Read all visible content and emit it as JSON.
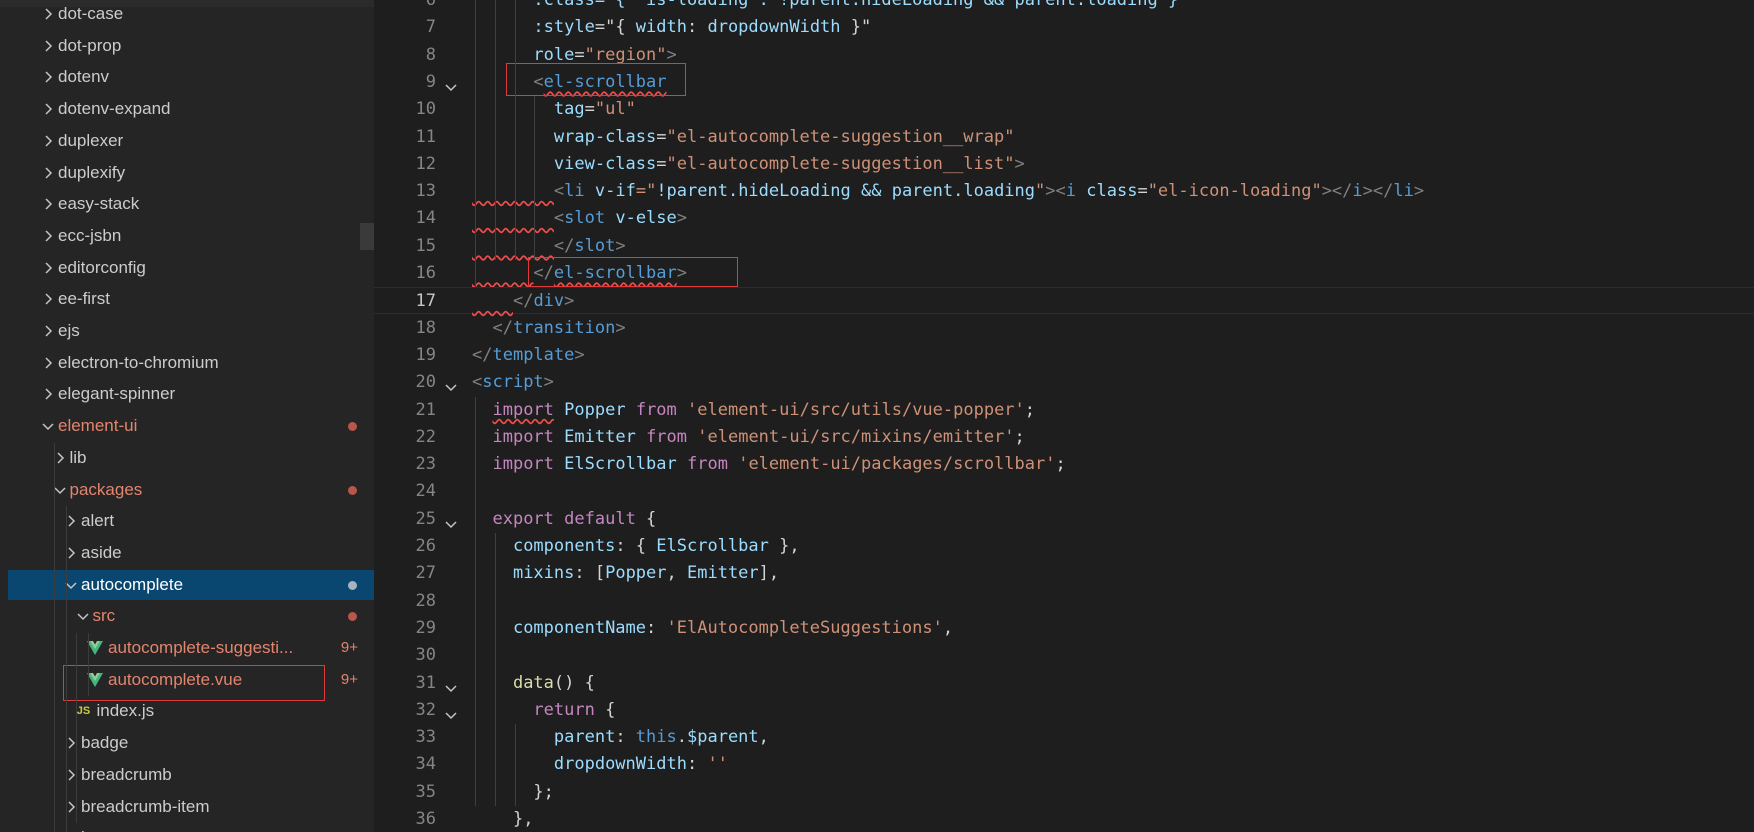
{
  "explorer": {
    "items": [
      {
        "label": "dot-case",
        "depth": 0,
        "chevron": "right",
        "icon": "chevron-right-icon"
      },
      {
        "label": "dot-prop",
        "depth": 0,
        "chevron": "right",
        "icon": "chevron-right-icon"
      },
      {
        "label": "dotenv",
        "depth": 0,
        "chevron": "right",
        "icon": "chevron-right-icon"
      },
      {
        "label": "dotenv-expand",
        "depth": 0,
        "chevron": "right",
        "icon": "chevron-right-icon"
      },
      {
        "label": "duplexer",
        "depth": 0,
        "chevron": "right",
        "icon": "chevron-right-icon"
      },
      {
        "label": "duplexify",
        "depth": 0,
        "chevron": "right",
        "icon": "chevron-right-icon"
      },
      {
        "label": "easy-stack",
        "depth": 0,
        "chevron": "right",
        "icon": "chevron-right-icon"
      },
      {
        "label": "ecc-jsbn",
        "depth": 0,
        "chevron": "right",
        "icon": "chevron-right-icon"
      },
      {
        "label": "editorconfig",
        "depth": 0,
        "chevron": "right",
        "icon": "chevron-right-icon"
      },
      {
        "label": "ee-first",
        "depth": 0,
        "chevron": "right",
        "icon": "chevron-right-icon"
      },
      {
        "label": "ejs",
        "depth": 0,
        "chevron": "right",
        "icon": "chevron-right-icon"
      },
      {
        "label": "electron-to-chromium",
        "depth": 0,
        "chevron": "right",
        "icon": "chevron-right-icon"
      },
      {
        "label": "elegant-spinner",
        "depth": 0,
        "chevron": "right",
        "icon": "chevron-right-icon"
      },
      {
        "label": "element-ui",
        "depth": 0,
        "chevron": "down",
        "modified": true,
        "dot": true,
        "icon": "chevron-down-icon"
      },
      {
        "label": "lib",
        "depth": 1,
        "chevron": "right",
        "icon": "chevron-right-icon"
      },
      {
        "label": "packages",
        "depth": 1,
        "chevron": "down",
        "modified": true,
        "dot": true,
        "icon": "chevron-down-icon"
      },
      {
        "label": "alert",
        "depth": 2,
        "chevron": "right",
        "icon": "chevron-right-icon"
      },
      {
        "label": "aside",
        "depth": 2,
        "chevron": "right",
        "icon": "chevron-right-icon"
      },
      {
        "label": "autocomplete",
        "depth": 2,
        "chevron": "down",
        "selected": true,
        "dot": true,
        "icon": "chevron-down-icon"
      },
      {
        "label": "src",
        "depth": 3,
        "chevron": "down",
        "modified": true,
        "dot": true,
        "icon": "chevron-down-icon"
      },
      {
        "label": "autocomplete-suggesti...",
        "depth": 4,
        "file": "vue",
        "modified": true,
        "badge": "9+",
        "icon": "vue-file-icon"
      },
      {
        "label": "autocomplete.vue",
        "depth": 4,
        "file": "vue",
        "modified": true,
        "badge": "9+",
        "icon": "vue-file-icon"
      },
      {
        "label": "index.js",
        "depth": 3,
        "file": "js",
        "icon": "js-file-icon"
      },
      {
        "label": "badge",
        "depth": 2,
        "chevron": "right",
        "icon": "chevron-right-icon"
      },
      {
        "label": "breadcrumb",
        "depth": 2,
        "chevron": "right",
        "icon": "chevron-right-icon"
      },
      {
        "label": "breadcrumb-item",
        "depth": 2,
        "chevron": "right",
        "icon": "chevron-right-icon"
      },
      {
        "label": "b",
        "depth": 2,
        "chevron": "right",
        "icon": "chevron-right-icon"
      }
    ],
    "js_badge": "JS"
  },
  "editor": {
    "current_line": "17",
    "lines": [
      {
        "n": "6",
        "fold": false,
        "tokens": [
          [
            "      ",
            "t-text"
          ],
          [
            ":class=\"{ 'is-loading': !parent.hideLoading && parent.loading }\"",
            "t-attr"
          ]
        ]
      },
      {
        "n": "7",
        "fold": false,
        "tokens": [
          [
            "      ",
            "t-text"
          ],
          [
            ":style",
            "t-attr"
          ],
          [
            "=\"{ ",
            "t-text"
          ],
          [
            "width",
            "t-var"
          ],
          [
            ": ",
            "t-text"
          ],
          [
            "dropdownWidth",
            "t-var"
          ],
          [
            " }\"",
            "t-text"
          ]
        ]
      },
      {
        "n": "8",
        "fold": false,
        "tokens": [
          [
            "      ",
            "t-text"
          ],
          [
            "role",
            "t-attr"
          ],
          [
            "=",
            "t-text"
          ],
          [
            "\"region\"",
            "t-str"
          ],
          [
            ">",
            "t-punc"
          ]
        ]
      },
      {
        "n": "9",
        "fold": true,
        "tokens": [
          [
            "      ",
            "t-text"
          ],
          [
            "<",
            "t-punc"
          ],
          [
            "el-scrollbar",
            "t-tag",
            "sq"
          ]
        ]
      },
      {
        "n": "10",
        "fold": false,
        "tokens": [
          [
            "        ",
            "t-text"
          ],
          [
            "tag",
            "t-attr"
          ],
          [
            "=",
            "t-text"
          ],
          [
            "\"ul\"",
            "t-str"
          ]
        ]
      },
      {
        "n": "11",
        "fold": false,
        "tokens": [
          [
            "        ",
            "t-text"
          ],
          [
            "wrap-class",
            "t-attr"
          ],
          [
            "=",
            "t-text"
          ],
          [
            "\"el-autocomplete-suggestion__wrap\"",
            "t-str"
          ]
        ]
      },
      {
        "n": "12",
        "fold": false,
        "tokens": [
          [
            "        ",
            "t-text"
          ],
          [
            "view-class",
            "t-attr"
          ],
          [
            "=",
            "t-text"
          ],
          [
            "\"el-autocomplete-suggestion__list\"",
            "t-str"
          ],
          [
            ">",
            "t-punc"
          ]
        ]
      },
      {
        "n": "13",
        "fold": false,
        "tokens": [
          [
            "        ",
            "t-text",
            "sq"
          ],
          [
            "<",
            "t-punc"
          ],
          [
            "li",
            "t-tag"
          ],
          [
            " ",
            "t-text"
          ],
          [
            "v-if",
            "t-attr"
          ],
          [
            "=\"",
            "t-str"
          ],
          [
            "!parent.hideLoading && parent.loading",
            "t-var"
          ],
          [
            "\"",
            "t-str"
          ],
          [
            "><",
            "t-punc"
          ],
          [
            "i",
            "t-tag"
          ],
          [
            " ",
            "t-text"
          ],
          [
            "class",
            "t-attr"
          ],
          [
            "=",
            "t-text"
          ],
          [
            "\"el-icon-loading\"",
            "t-str"
          ],
          [
            "></",
            "t-punc"
          ],
          [
            "i",
            "t-tag"
          ],
          [
            "></",
            "t-punc"
          ],
          [
            "li",
            "t-tag"
          ],
          [
            ">",
            "t-punc"
          ]
        ]
      },
      {
        "n": "14",
        "fold": false,
        "tokens": [
          [
            "        ",
            "t-text",
            "sq"
          ],
          [
            "<",
            "t-punc"
          ],
          [
            "slot",
            "t-tag"
          ],
          [
            " ",
            "t-text"
          ],
          [
            "v-else",
            "t-attr"
          ],
          [
            ">",
            "t-punc"
          ]
        ]
      },
      {
        "n": "15",
        "fold": false,
        "tokens": [
          [
            "        ",
            "t-text",
            "sq"
          ],
          [
            "</",
            "t-punc"
          ],
          [
            "slot",
            "t-tag"
          ],
          [
            ">",
            "t-punc"
          ]
        ]
      },
      {
        "n": "16",
        "fold": false,
        "tokens": [
          [
            "      ",
            "t-text",
            "sq"
          ],
          [
            "</",
            "t-punc"
          ],
          [
            "el-scrollbar",
            "t-tag",
            "sq"
          ],
          [
            ">",
            "t-punc"
          ]
        ]
      },
      {
        "n": "17",
        "fold": false,
        "tokens": [
          [
            "    ",
            "t-text",
            "sq"
          ],
          [
            "</",
            "t-punc"
          ],
          [
            "div",
            "t-tag"
          ],
          [
            ">",
            "t-punc"
          ]
        ]
      },
      {
        "n": "18",
        "fold": false,
        "tokens": [
          [
            "  ",
            "t-text"
          ],
          [
            "</",
            "t-punc"
          ],
          [
            "transition",
            "t-tag"
          ],
          [
            ">",
            "t-punc"
          ]
        ]
      },
      {
        "n": "19",
        "fold": false,
        "tokens": [
          [
            "</",
            "t-punc"
          ],
          [
            "template",
            "t-tag"
          ],
          [
            ">",
            "t-punc"
          ]
        ]
      },
      {
        "n": "20",
        "fold": true,
        "tokens": [
          [
            "<",
            "t-punc"
          ],
          [
            "script",
            "t-tag"
          ],
          [
            ">",
            "t-punc"
          ]
        ]
      },
      {
        "n": "21",
        "fold": false,
        "tokens": [
          [
            "  ",
            "t-text"
          ],
          [
            "import",
            "t-kw",
            "sq"
          ],
          [
            " ",
            "t-text"
          ],
          [
            "Popper",
            "t-var"
          ],
          [
            " ",
            "t-text"
          ],
          [
            "from",
            "t-kw"
          ],
          [
            " ",
            "t-text"
          ],
          [
            "'element-ui/src/utils/vue-popper'",
            "t-str"
          ],
          [
            ";",
            "t-text"
          ]
        ]
      },
      {
        "n": "22",
        "fold": false,
        "tokens": [
          [
            "  ",
            "t-text"
          ],
          [
            "import",
            "t-kw"
          ],
          [
            " ",
            "t-text"
          ],
          [
            "Emitter",
            "t-var"
          ],
          [
            " ",
            "t-text"
          ],
          [
            "from",
            "t-kw"
          ],
          [
            " ",
            "t-text"
          ],
          [
            "'element-ui/src/mixins/emitter'",
            "t-str"
          ],
          [
            ";",
            "t-text"
          ]
        ]
      },
      {
        "n": "23",
        "fold": false,
        "tokens": [
          [
            "  ",
            "t-text"
          ],
          [
            "import",
            "t-kw"
          ],
          [
            " ",
            "t-text"
          ],
          [
            "ElScrollbar",
            "t-var"
          ],
          [
            " ",
            "t-text"
          ],
          [
            "from",
            "t-kw"
          ],
          [
            " ",
            "t-text"
          ],
          [
            "'element-ui/packages/scrollbar'",
            "t-str"
          ],
          [
            ";",
            "t-text"
          ]
        ]
      },
      {
        "n": "24",
        "fold": false,
        "tokens": []
      },
      {
        "n": "25",
        "fold": true,
        "tokens": [
          [
            "  ",
            "t-text"
          ],
          [
            "export",
            "t-kw"
          ],
          [
            " ",
            "t-text"
          ],
          [
            "default",
            "t-kw"
          ],
          [
            " {",
            "t-text"
          ]
        ]
      },
      {
        "n": "26",
        "fold": false,
        "tokens": [
          [
            "    ",
            "t-text"
          ],
          [
            "components",
            "t-var"
          ],
          [
            ": { ",
            "t-text"
          ],
          [
            "ElScrollbar",
            "t-var"
          ],
          [
            " },",
            "t-text"
          ]
        ]
      },
      {
        "n": "27",
        "fold": false,
        "tokens": [
          [
            "    ",
            "t-text"
          ],
          [
            "mixins",
            "t-var"
          ],
          [
            ": [",
            "t-text"
          ],
          [
            "Popper",
            "t-var"
          ],
          [
            ", ",
            "t-text"
          ],
          [
            "Emitter",
            "t-var"
          ],
          [
            "],",
            "t-text"
          ]
        ]
      },
      {
        "n": "28",
        "fold": false,
        "tokens": []
      },
      {
        "n": "29",
        "fold": false,
        "tokens": [
          [
            "    ",
            "t-text"
          ],
          [
            "componentName",
            "t-var"
          ],
          [
            ": ",
            "t-text"
          ],
          [
            "'ElAutocompleteSuggestions'",
            "t-str"
          ],
          [
            ",",
            "t-text"
          ]
        ]
      },
      {
        "n": "30",
        "fold": false,
        "tokens": []
      },
      {
        "n": "31",
        "fold": true,
        "tokens": [
          [
            "    ",
            "t-text"
          ],
          [
            "data",
            "t-fn"
          ],
          [
            "() {",
            "t-text"
          ]
        ]
      },
      {
        "n": "32",
        "fold": true,
        "tokens": [
          [
            "      ",
            "t-text"
          ],
          [
            "return",
            "t-kw"
          ],
          [
            " {",
            "t-text"
          ]
        ]
      },
      {
        "n": "33",
        "fold": false,
        "tokens": [
          [
            "        ",
            "t-text"
          ],
          [
            "parent",
            "t-var"
          ],
          [
            ": ",
            "t-text"
          ],
          [
            "this",
            "t-blue"
          ],
          [
            ".",
            "t-text"
          ],
          [
            "$parent",
            "t-var"
          ],
          [
            ",",
            "t-text"
          ]
        ]
      },
      {
        "n": "34",
        "fold": false,
        "tokens": [
          [
            "        ",
            "t-text"
          ],
          [
            "dropdownWidth",
            "t-var"
          ],
          [
            ": ",
            "t-text"
          ],
          [
            "''",
            "t-str"
          ]
        ]
      },
      {
        "n": "35",
        "fold": false,
        "tokens": [
          [
            "      ",
            "t-text"
          ],
          [
            "};",
            "t-text"
          ]
        ]
      },
      {
        "n": "36",
        "fold": false,
        "tokens": [
          [
            "    ",
            "t-text"
          ],
          [
            "},",
            "t-text"
          ]
        ]
      }
    ]
  }
}
